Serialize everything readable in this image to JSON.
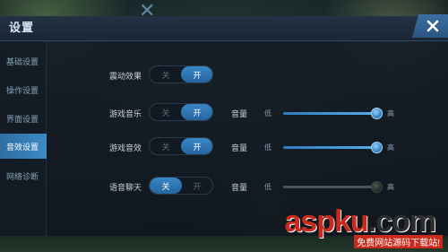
{
  "header": {
    "title": "设置"
  },
  "sidebar": {
    "items": [
      {
        "label": "基础设置"
      },
      {
        "label": "操作设置"
      },
      {
        "label": "界面设置"
      },
      {
        "label": "音效设置"
      },
      {
        "label": "网络诊断"
      }
    ],
    "active_index": 3
  },
  "settings": {
    "vibration": {
      "label": "震动效果",
      "off": "关",
      "on": "开",
      "state": "on"
    },
    "music": {
      "label": "游戏音乐",
      "off": "关",
      "on": "开",
      "state": "on",
      "volume_label": "音量",
      "low": "低",
      "high": "高",
      "volume": 1.0
    },
    "sfx": {
      "label": "游戏音效",
      "off": "关",
      "on": "开",
      "state": "on",
      "volume_label": "音量",
      "low": "低",
      "high": "高",
      "volume": 1.0
    },
    "voice_chat": {
      "label": "语音聊天",
      "off": "关",
      "on": "开",
      "state": "off",
      "volume_label": "音量",
      "low": "低",
      "high": "高",
      "volume": 1.0
    }
  },
  "watermark": {
    "brand": "aspku",
    "tld": ".com",
    "tagline": "免费网站源码下载站!"
  },
  "colors": {
    "accent": "#3a86c6",
    "panel": "#161e28",
    "watermark_red": "#c92a1c"
  }
}
